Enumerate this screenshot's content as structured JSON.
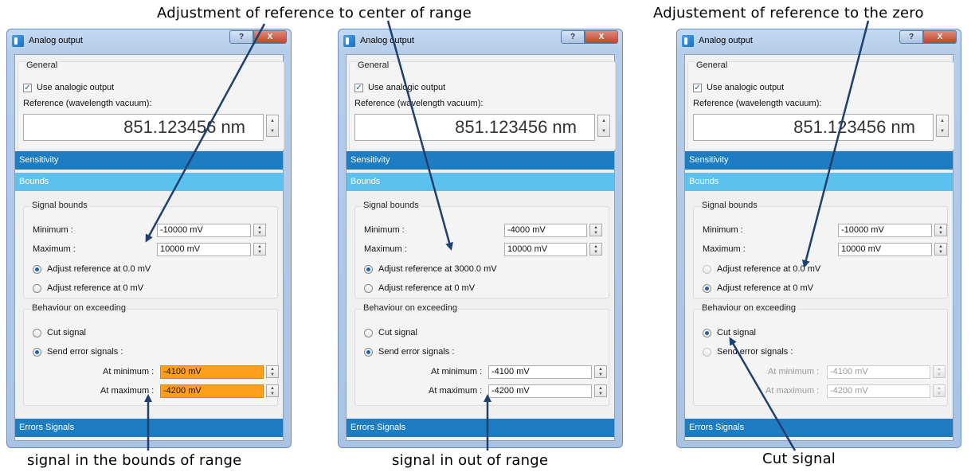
{
  "captions": {
    "top_center": "Adjustment of reference to center of range",
    "top_right": "Adjustement of reference to the zero",
    "bottom_left": "signal in the bounds of range",
    "bottom_center": "signal in out of range",
    "bottom_right": "Cut signal"
  },
  "windows": [
    {
      "title": "Analog output",
      "help": "?",
      "close": "X",
      "general_title": "General",
      "use_output": "Use analogic output",
      "reference_label": "Reference (wavelength vacuum):",
      "reference_value": "851.123456 nm",
      "sensitivity": "Sensitivity",
      "bounds": "Bounds",
      "signal_bounds_title": "Signal bounds",
      "minimum_label": "Minimum :",
      "minimum_value": "-10000 mV",
      "maximum_label": "Maximum :",
      "maximum_value": "10000 mV",
      "adjust_1": "Adjust reference at 0.0 mV",
      "adjust_2": "Adjust reference at 0 mV",
      "behaviour_title": "Behaviour on exceeding",
      "cut_signal": "Cut signal",
      "send_error": "Send error signals :",
      "at_min_label": "At minimum :",
      "at_min_value": "-4100 mV",
      "at_max_label": "At maximum :",
      "at_max_value": "-4200 mV",
      "errors_signals": "Errors Signals"
    },
    {
      "title": "Analog output",
      "help": "?",
      "close": "X",
      "general_title": "General",
      "use_output": "Use analogic output",
      "reference_label": "Reference (wavelength vacuum):",
      "reference_value": "851.123456 nm",
      "sensitivity": "Sensitivity",
      "bounds": "Bounds",
      "signal_bounds_title": "Signal bounds",
      "minimum_label": "Minimum :",
      "minimum_value": "-4000 mV",
      "maximum_label": "Maximum :",
      "maximum_value": "10000 mV",
      "adjust_1": "Adjust reference at 3000.0 mV",
      "adjust_2": "Adjust reference at 0 mV",
      "behaviour_title": "Behaviour on exceeding",
      "cut_signal": "Cut signal",
      "send_error": "Send error signals :",
      "at_min_label": "At minimum :",
      "at_min_value": "-4100 mV",
      "at_max_label": "At maximum :",
      "at_max_value": "-4200 mV",
      "errors_signals": "Errors Signals"
    },
    {
      "title": "Analog output",
      "help": "?",
      "close": "X",
      "general_title": "General",
      "use_output": "Use analogic output",
      "reference_label": "Reference (wavelength vacuum):",
      "reference_value": "851.123456 nm",
      "sensitivity": "Sensitivity",
      "bounds": "Bounds",
      "signal_bounds_title": "Signal bounds",
      "minimum_label": "Minimum :",
      "minimum_value": "-10000 mV",
      "maximum_label": "Maximum :",
      "maximum_value": "10000 mV",
      "adjust_1": "Adjust reference at 0.0 mV",
      "adjust_2": "Adjust reference at 0 mV",
      "behaviour_title": "Behaviour on exceeding",
      "cut_signal": "Cut signal",
      "send_error": "Send error signals :",
      "at_min_label": "At minimum :",
      "at_min_value": "-4100 mV",
      "at_max_label": "At maximum :",
      "at_max_value": "-4200 mV",
      "errors_signals": "Errors Signals"
    }
  ],
  "colors": {
    "section_dark": "#1e7dc2",
    "section_light": "#5cc1ef",
    "error_field_highlight": "#ff9f1c",
    "arrow": "#1f3f6e"
  }
}
